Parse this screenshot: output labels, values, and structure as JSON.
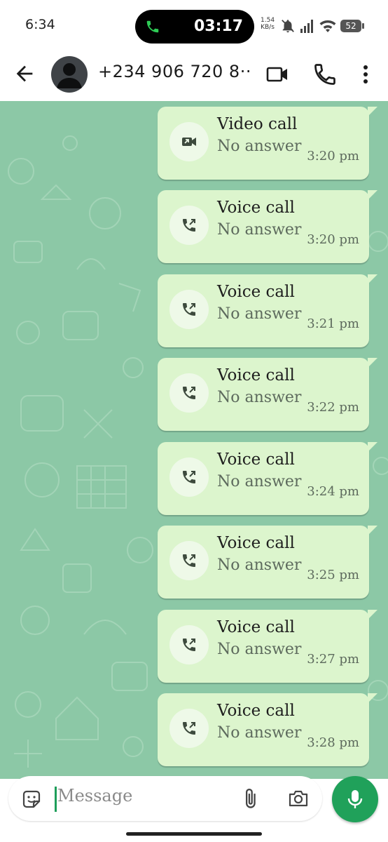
{
  "status_bar": {
    "time": "6:34",
    "call_duration": "03:17",
    "network_speed_value": "1.54",
    "network_speed_unit": "KB/s",
    "battery": "52",
    "icons": [
      "phone-icon",
      "mute-icon",
      "signal-icon",
      "wifi-icon",
      "battery-icon"
    ]
  },
  "header": {
    "contact_name": "+234 906 720 8···",
    "icons": [
      "back-arrow-icon",
      "avatar",
      "video-call-icon",
      "voice-call-icon",
      "more-options-icon"
    ]
  },
  "messages": [
    {
      "type": "video",
      "title": "Video call",
      "status": "No answer",
      "time": "3:20 pm",
      "icon": "missed-video-call-icon"
    },
    {
      "type": "voice",
      "title": "Voice call",
      "status": "No answer",
      "time": "3:20 pm",
      "icon": "outgoing-voice-call-icon"
    },
    {
      "type": "voice",
      "title": "Voice call",
      "status": "No answer",
      "time": "3:21 pm",
      "icon": "outgoing-voice-call-icon"
    },
    {
      "type": "voice",
      "title": "Voice call",
      "status": "No answer",
      "time": "3:22 pm",
      "icon": "outgoing-voice-call-icon"
    },
    {
      "type": "voice",
      "title": "Voice call",
      "status": "No answer",
      "time": "3:24 pm",
      "icon": "outgoing-voice-call-icon"
    },
    {
      "type": "voice",
      "title": "Voice call",
      "status": "No answer",
      "time": "3:25 pm",
      "icon": "outgoing-voice-call-icon"
    },
    {
      "type": "voice",
      "title": "Voice call",
      "status": "No answer",
      "time": "3:27 pm",
      "icon": "outgoing-voice-call-icon"
    },
    {
      "type": "voice",
      "title": "Voice call",
      "status": "No answer",
      "time": "3:28 pm",
      "icon": "outgoing-voice-call-icon"
    }
  ],
  "composer": {
    "placeholder": "Message",
    "icons": [
      "sticker-icon",
      "attach-icon",
      "camera-icon",
      "mic-icon"
    ]
  },
  "colors": {
    "chat_background": "#8cc8a6",
    "bubble": "#dcf5cd",
    "accent_green": "#20a15a"
  }
}
